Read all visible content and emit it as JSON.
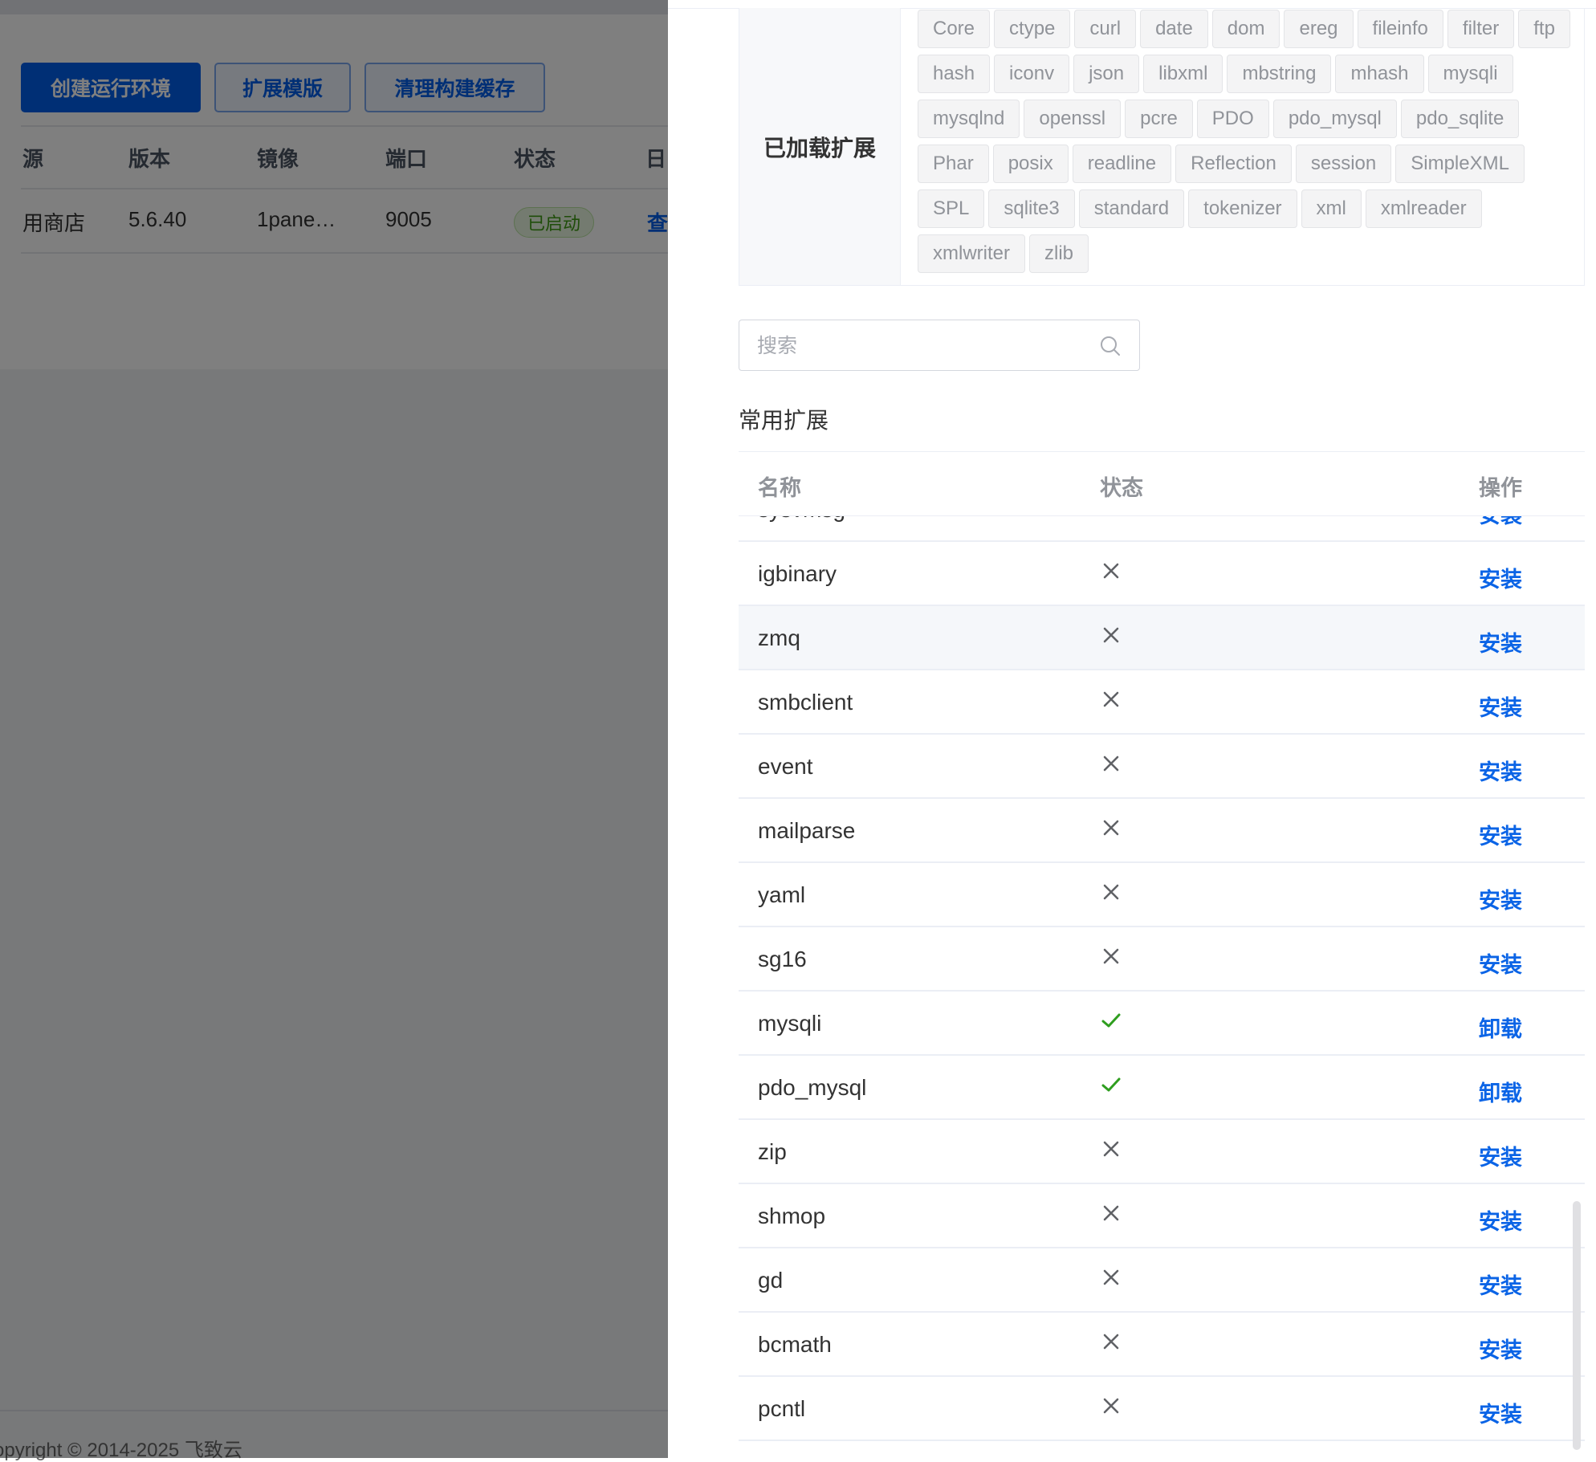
{
  "background": {
    "buttons": [
      "创建运行环境",
      "扩展模版",
      "清理构建缓存"
    ],
    "table": {
      "headers": [
        "源",
        "版本",
        "镜像",
        "端口",
        "状态",
        "日"
      ],
      "row": {
        "source": "用商店",
        "version": "5.6.40",
        "image": "1pane…",
        "port": "9005",
        "status": "已启动",
        "action": "查"
      }
    },
    "footer": "opyright © 2014-2025 飞致云"
  },
  "drawer": {
    "loaded_label": "已加载扩展",
    "loaded_extensions": [
      "Core",
      "ctype",
      "curl",
      "date",
      "dom",
      "ereg",
      "fileinfo",
      "filter",
      "ftp",
      "hash",
      "iconv",
      "json",
      "libxml",
      "mbstring",
      "mhash",
      "mysqli",
      "mysqlnd",
      "openssl",
      "pcre",
      "PDO",
      "pdo_mysql",
      "pdo_sqlite",
      "Phar",
      "posix",
      "readline",
      "Reflection",
      "session",
      "SimpleXML",
      "SPL",
      "sqlite3",
      "standard",
      "tokenizer",
      "xml",
      "xmlreader",
      "xmlwriter",
      "zlib"
    ],
    "search": {
      "placeholder": "搜索",
      "value": ""
    },
    "section_title": "常用扩展",
    "table": {
      "headers": {
        "name": "名称",
        "status": "状态",
        "action": "操作"
      },
      "rows": [
        {
          "name": "sysvmsg",
          "installed": false,
          "action": "安装"
        },
        {
          "name": "igbinary",
          "installed": false,
          "action": "安装"
        },
        {
          "name": "zmq",
          "installed": false,
          "action": "安装"
        },
        {
          "name": "smbclient",
          "installed": false,
          "action": "安装"
        },
        {
          "name": "event",
          "installed": false,
          "action": "安装"
        },
        {
          "name": "mailparse",
          "installed": false,
          "action": "安装"
        },
        {
          "name": "yaml",
          "installed": false,
          "action": "安装"
        },
        {
          "name": "sg16",
          "installed": false,
          "action": "安装"
        },
        {
          "name": "mysqli",
          "installed": true,
          "action": "卸载"
        },
        {
          "name": "pdo_mysql",
          "installed": true,
          "action": "卸载"
        },
        {
          "name": "zip",
          "installed": false,
          "action": "安装"
        },
        {
          "name": "shmop",
          "installed": false,
          "action": "安装"
        },
        {
          "name": "gd",
          "installed": false,
          "action": "安装"
        },
        {
          "name": "bcmath",
          "installed": false,
          "action": "安装"
        },
        {
          "name": "pcntl",
          "installed": false,
          "action": "安装"
        }
      ]
    }
  },
  "icons": {
    "installed": "check-icon",
    "not_installed": "close-icon",
    "search": "search-icon"
  },
  "colors": {
    "primary": "#005eeb",
    "link": "#0b64e6",
    "success": "#2f9e1f",
    "muted": "#606266"
  }
}
